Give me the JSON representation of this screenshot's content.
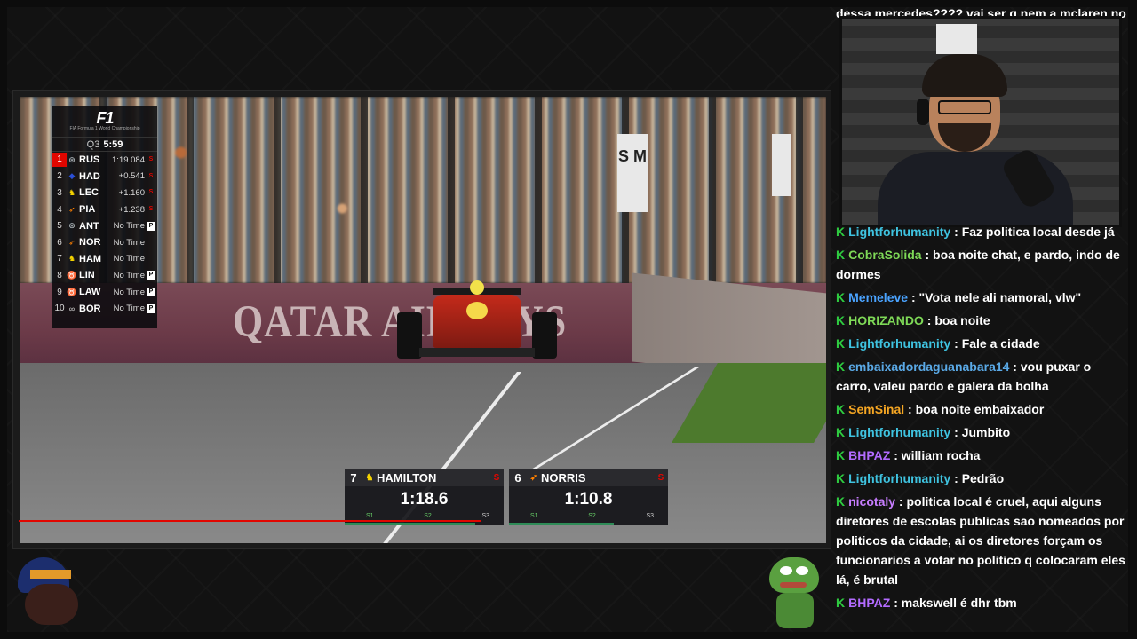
{
  "leaderboard": {
    "logo": "F1",
    "logo_sub": "FIA Formula 1 World Championship",
    "session_label": "Q3",
    "session_clock": "5:59",
    "rows": [
      {
        "pos": "1",
        "team_icon": "mercedes-icon",
        "code": "RUS",
        "time": "1:19.084",
        "flag": "S"
      },
      {
        "pos": "2",
        "team_icon": "redbull-icon",
        "code": "HAD",
        "time": "+0.541",
        "flag": "S"
      },
      {
        "pos": "3",
        "team_icon": "ferrari-icon",
        "code": "LEC",
        "time": "+1.160",
        "flag": "S"
      },
      {
        "pos": "4",
        "team_icon": "mclaren-icon",
        "code": "PIA",
        "time": "+1.238",
        "flag": "S"
      },
      {
        "pos": "5",
        "team_icon": "mercedes-icon",
        "code": "ANT",
        "time": "No Time",
        "flag": "P"
      },
      {
        "pos": "6",
        "team_icon": "mclaren-icon",
        "code": "NOR",
        "time": "No Time",
        "flag": ""
      },
      {
        "pos": "7",
        "team_icon": "ferrari-icon",
        "code": "HAM",
        "time": "No Time",
        "flag": ""
      },
      {
        "pos": "8",
        "team_icon": "racingbulls-icon",
        "code": "LIN",
        "time": "No Time",
        "flag": "P"
      },
      {
        "pos": "9",
        "team_icon": "racingbulls-icon",
        "code": "LAW",
        "time": "No Time",
        "flag": "P"
      },
      {
        "pos": "10",
        "team_icon": "audi-icon",
        "code": "BOR",
        "time": "No Time",
        "flag": "P"
      }
    ]
  },
  "drivers": [
    {
      "number": "7",
      "name": "HAMILTON",
      "tyre": "S",
      "lap_time": "1:18.6",
      "sectors": [
        "S1",
        "S2",
        "S3"
      ],
      "progress": 0.82
    },
    {
      "number": "6",
      "name": "NORRIS",
      "tyre": "S",
      "lap_time": "1:10.8",
      "sectors": [
        "S1",
        "S2",
        "S3"
      ],
      "progress": 0.66
    }
  ],
  "scene": {
    "wall_text": "QATAR AIRWAYS",
    "sign_text": "S M"
  },
  "chat": {
    "top_line": "dessa mercedes???? vai ser q nem a mclaren no",
    "messages": [
      {
        "user": "Lightforhumanity",
        "user_color": "#3fc3e0",
        "badge": "K",
        "text": "Faz politica local desde já"
      },
      {
        "user": "CobraSolida",
        "user_color": "#7ed957",
        "badge": "K",
        "text": "boa noite chat, e pardo, indo de dormes"
      },
      {
        "user": "Memeleve",
        "user_color": "#4aa3ff",
        "badge": "K",
        "text": "\"Vota nele ali namoral, vlw\""
      },
      {
        "user": "HORIZANDO",
        "user_color": "#7ed957",
        "badge": "K",
        "text": "boa noite"
      },
      {
        "user": "Lightforhumanity",
        "user_color": "#3fc3e0",
        "badge": "K",
        "text": "Fale a cidade"
      },
      {
        "user": "embaixadordaguanabara14",
        "user_color": "#5aa9e6",
        "badge": "K",
        "text": "vou puxar o carro, valeu pardo e galera da bolha"
      },
      {
        "user": "SemSinal",
        "user_color": "#f5a623",
        "badge": "K",
        "text": "boa noite embaixador"
      },
      {
        "user": "Lightforhumanity",
        "user_color": "#3fc3e0",
        "badge": "K",
        "text": "Jumbito"
      },
      {
        "user": "BHPAZ",
        "user_color": "#b36bff",
        "badge": "K",
        "text": "william rocha"
      },
      {
        "user": "Lightforhumanity",
        "user_color": "#3fc3e0",
        "badge": "K",
        "text": "Pedrão"
      },
      {
        "user": "nicotaly",
        "user_color": "#c77dff",
        "badge": "K",
        "text": "politica local é cruel, aqui alguns diretores de escolas publicas sao nomeados por politicos da cidade, ai os diretores forçam os funcionarios a votar no politico q colocaram eles lá, é brutal"
      },
      {
        "user": "BHPAZ",
        "user_color": "#b36bff",
        "badge": "K",
        "text": "makswell é dhr tbm"
      }
    ]
  }
}
